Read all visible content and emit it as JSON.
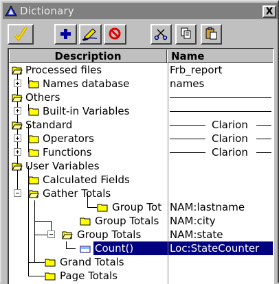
{
  "window": {
    "title": "Dictionary",
    "close_label": "X"
  },
  "toolbar": {
    "buttons": [
      {
        "name": "ok-button",
        "icon": "checkmark-icon"
      },
      {
        "name": "add-button",
        "icon": "plus-icon"
      },
      {
        "name": "edit-button",
        "icon": "pencil-icon"
      },
      {
        "name": "delete-button",
        "icon": "no-icon"
      },
      {
        "name": "cut-button",
        "icon": "scissors-icon"
      },
      {
        "name": "copy-button",
        "icon": "copy-icon"
      },
      {
        "name": "paste-button",
        "icon": "paste-icon"
      }
    ]
  },
  "columns": {
    "description": "Description",
    "name": "Name"
  },
  "rows": [
    {
      "label": "Processed files",
      "name": "Frb_report"
    },
    {
      "label": "Names database",
      "name": "names"
    },
    {
      "label": "Others",
      "name": ""
    },
    {
      "label": "Built-in Variables",
      "name": ""
    },
    {
      "label": "Standard",
      "name": ""
    },
    {
      "label": "Operators",
      "name": "Clarion"
    },
    {
      "label": "Functions",
      "name": "Clarion"
    },
    {
      "label": "User Variables",
      "name": ""
    },
    {
      "label": "Calculated Fields",
      "name": ""
    },
    {
      "label": "Gather Totals",
      "name": ""
    },
    {
      "label": "Group Tot",
      "name": "NAM:lastname"
    },
    {
      "label": "Group Totals",
      "name": "NAM:city"
    },
    {
      "label": "Group Totals",
      "name": "NAM:state"
    },
    {
      "label": "Count()",
      "name": "Loc:StateCounter"
    },
    {
      "label": "Grand Totals",
      "name": ""
    },
    {
      "label": "Page Totals",
      "name": ""
    }
  ],
  "colors": {
    "selection": "#000080",
    "folder": "#ffff00",
    "titlebar": "#808080"
  }
}
